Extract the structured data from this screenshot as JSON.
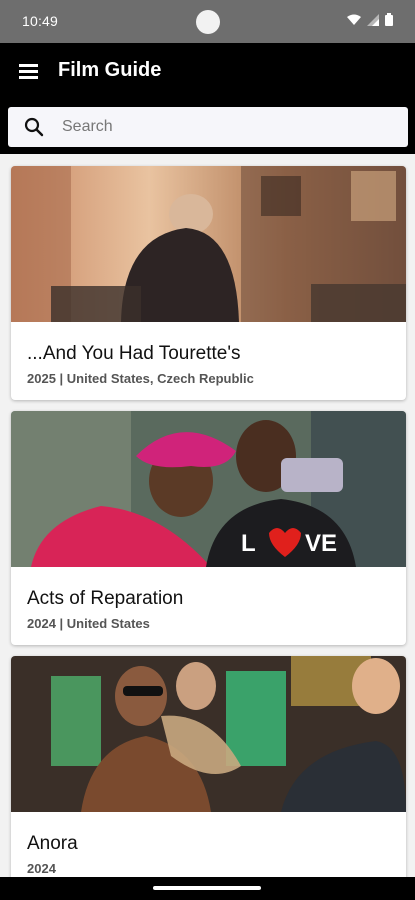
{
  "status_bar": {
    "time": "10:49",
    "icons": [
      "wifi-icon",
      "signal-icon",
      "battery-icon"
    ]
  },
  "app_bar": {
    "title": "Film Guide",
    "menu_icon": "hamburger-menu-icon"
  },
  "search": {
    "placeholder": "Search",
    "value": "",
    "icon": "search-icon"
  },
  "films": [
    {
      "title": "...And You Had Tourette's",
      "meta": "2025 | United States, Czech Republic"
    },
    {
      "title": "Acts of Reparation",
      "meta": "2024 | United States"
    },
    {
      "title": "Anora",
      "meta": "2024"
    }
  ],
  "colors": {
    "status_bar": "#6e6e6e",
    "app_bar": "#000000",
    "list_background": "#f2f2f2",
    "card": "#ffffff"
  }
}
